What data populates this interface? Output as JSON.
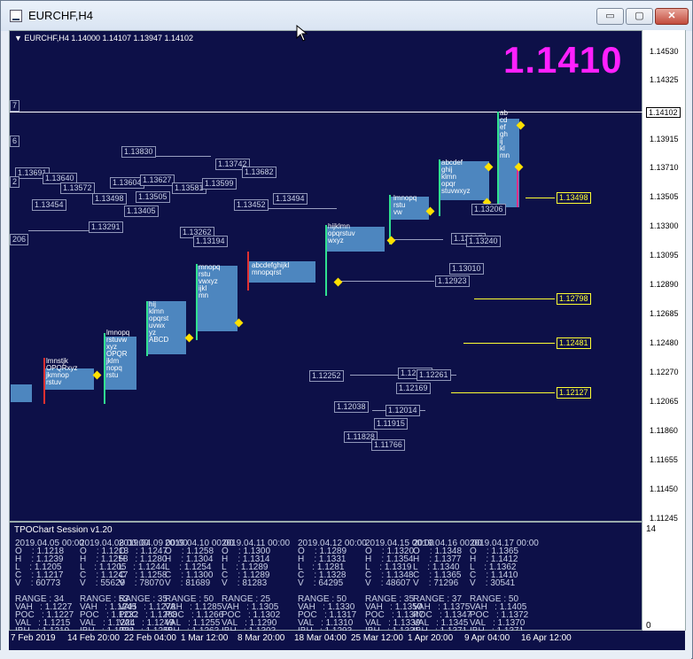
{
  "window": {
    "title": "EURCHF,H4",
    "minimize": "▭",
    "maximize": "▢",
    "close": "✕"
  },
  "chart": {
    "symbol_line": "EURCHF,H4  1.14000 1.14107 1.13947 1.14102",
    "big_price": "1.1410",
    "current_price": "1.14102",
    "colors": {
      "background": "#0d1048",
      "big_price": "#ff20ff",
      "levels": "#ffff33",
      "profile": "#4d86bf"
    }
  },
  "y_axis": {
    "labels": [
      "1.14530",
      "1.14325",
      "1.13915",
      "1.13710",
      "1.13505",
      "1.13300",
      "1.13095",
      "1.12890",
      "1.12685",
      "1.12480",
      "1.12270",
      "1.12065",
      "1.11860",
      "1.11655",
      "1.11450",
      "1.11245"
    ]
  },
  "yellow_levels": [
    "1.13498",
    "1.12798",
    "1.12481",
    "1.12127"
  ],
  "gray_boxes": [
    "1.13830",
    "1.13691",
    "1.13640",
    "1.13572",
    "1.13498",
    "1.13454",
    "1.13604",
    "1.13627",
    "1.13505",
    "1.13581",
    "1.13599",
    "1.13405",
    "1.13291",
    "1.13742",
    "1.13682",
    "1.13452",
    "1.13494",
    "1.13262",
    "1.13194",
    "1.13217",
    "1.13010",
    "1.12923",
    "1.12252",
    "1.12273",
    "1.12261",
    "1.12169",
    "1.12038",
    "1.12014",
    "1.11915",
    "1.11828",
    "1.11766",
    "1.13206",
    "1.13261",
    "1.13240"
  ],
  "edge_labels": [
    "7",
    "6",
    "2",
    "206"
  ],
  "panel": {
    "title": "TPOChart Session v1.20",
    "scale_top": "14",
    "scale_bottom": "0",
    "sessions": [
      {
        "date": "2019.04.05 00:00",
        "O": "1.1218",
        "H": "1.1239",
        "L": "1.1205",
        "C": "1.1217",
        "V": "60773",
        "RANGE": "34",
        "VAH": "1.1227",
        "POC": "1.1227",
        "VAL": "1.1215",
        "IBH": "1.1219",
        "IBL": "1.1205"
      },
      {
        "date": "2019.04.08 00:00",
        "O": "1.1213",
        "H": "1.1258",
        "L": "1.1205",
        "C": "1.1247",
        "V": "55629",
        "RANGE": "53",
        "VAH": "1.1245",
        "POC": "1.1232",
        "VAL": "1.1224",
        "IBH": "1.1238",
        "IBL": "1.1205"
      },
      {
        "date": "2019.04.09 00:00",
        "O": "1.1247",
        "H": "1.1280",
        "L": "1.1244",
        "C": "1.1258",
        "V": "78070",
        "RANGE": "35",
        "VAH": "1.1278",
        "POC": "1.1268",
        "VAL": "1.1249",
        "IBH": "1.1258",
        "IBL": "1.1244"
      },
      {
        "date": "2019.04.10 00:00",
        "O": "1.1258",
        "H": "1.1304",
        "L": "1.1254",
        "C": "1.1300",
        "V": "81689",
        "RANGE": "50",
        "VAH": "1.1285",
        "POC": "1.1266",
        "VAL": "1.1255",
        "IBH": "1.1263",
        "IBL": "1.1258"
      },
      {
        "date": "2019.04.11 00:00",
        "O": "1.1300",
        "H": "1.1314",
        "L": "1.1289",
        "C": "1.1289",
        "V": "81283",
        "RANGE": "25",
        "VAH": "1.1305",
        "POC": "1.1302",
        "VAL": "1.1290",
        "IBH": "1.1303",
        "IBL": "1.1292"
      },
      {
        "date": "2019.04.12 00:00",
        "O": "1.1289",
        "H": "1.1331",
        "L": "1.1281",
        "C": "1.1328",
        "V": "64295",
        "RANGE": "50",
        "VAH": "1.1330",
        "POC": "1.1317",
        "VAL": "1.1310",
        "IBH": "1.1293",
        "IBL": "1.1281"
      },
      {
        "date": "2019.04.15 00:00",
        "O": "1.1320",
        "H": "1.1354",
        "L": "1.1319",
        "C": "1.1348",
        "V": "48607",
        "RANGE": "35",
        "VAH": "1.1350",
        "POC": "1.1347",
        "VAL": "1.1339",
        "IBH": "1.1331",
        "IBL": "1.1319"
      },
      {
        "date": "2019.04.16 00:00",
        "O": "1.1348",
        "H": "1.1377",
        "L": "1.1340",
        "C": "1.1365",
        "V": "71296",
        "RANGE": "37",
        "VAH": "1.1375",
        "POC": "1.1347",
        "VAL": "1.1345",
        "IBH": "1.1371",
        "IBL": "1.1340"
      },
      {
        "date": "2019.04.17 00:00",
        "O": "1.1365",
        "H": "1.1412",
        "L": "1.1362",
        "C": "1.1410",
        "V": "30541",
        "RANGE": "50",
        "VAH": "1.1405",
        "POC": "1.1372",
        "VAL": "1.1370",
        "IBH": "1.1371",
        "IBL": "1.1362"
      }
    ]
  },
  "x_axis": {
    "labels": [
      "7 Feb 2019",
      "14 Feb 20:00",
      "22 Feb 04:00",
      "1 Mar 12:00",
      "8 Mar 20:00",
      "18 Mar 04:00",
      "25 Mar 12:00",
      "1 Apr 20:00",
      "9 Apr 04:00",
      "16 Apr 12:00"
    ]
  }
}
